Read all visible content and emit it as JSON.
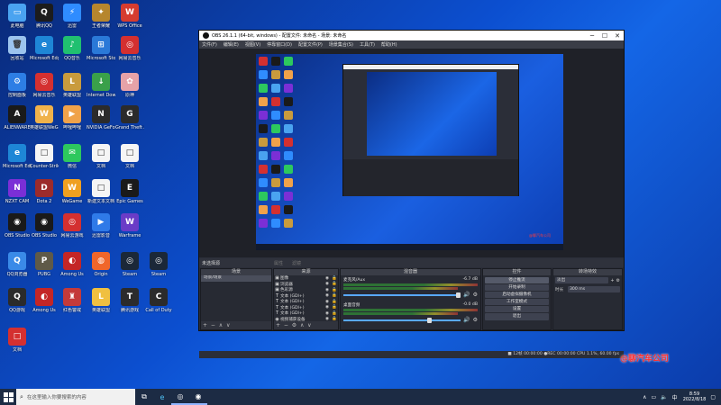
{
  "desktop": {
    "icons": [
      {
        "label": "此电脑",
        "color": "#4aa3f0",
        "glyph": "▭"
      },
      {
        "label": "腾讯QQ",
        "color": "#1c1c1c",
        "glyph": "Q"
      },
      {
        "label": "迅雷",
        "color": "#2f8cff",
        "glyph": "⚡"
      },
      {
        "label": "王者荣耀",
        "color": "#b6862e",
        "glyph": "✦"
      },
      {
        "label": "WPS Office",
        "color": "#d63c2f",
        "glyph": "W"
      },
      {
        "label": "回收站",
        "color": "#9cc4ee",
        "glyph": "🗑"
      },
      {
        "label": "Microsoft Edge",
        "color": "#1e86d6",
        "glyph": "e"
      },
      {
        "label": "QQ音乐",
        "color": "#20c070",
        "glyph": "♪"
      },
      {
        "label": "Microsoft Store",
        "color": "#2a79d8",
        "glyph": "⊞"
      },
      {
        "label": "网易云音乐",
        "color": "#d43030",
        "glyph": "◎"
      },
      {
        "label": "控制面板",
        "color": "#2d7ee5",
        "glyph": "⚙"
      },
      {
        "label": "网易云音乐",
        "color": "#d43030",
        "glyph": "◎"
      },
      {
        "label": "英雄联盟",
        "color": "#c99b3d",
        "glyph": "L"
      },
      {
        "label": "Internet Downloader",
        "color": "#3aa04a",
        "glyph": "↓"
      },
      {
        "label": "原神",
        "color": "#e6a2a8",
        "glyph": "✿"
      },
      {
        "label": "ALIENWARE",
        "color": "#1a1a1a",
        "glyph": "A"
      },
      {
        "label": "英雄联盟WeGame",
        "color": "#f0b24a",
        "glyph": "W"
      },
      {
        "label": "哔哩哔哩",
        "color": "#f0a24a",
        "glyph": "▶"
      },
      {
        "label": "NVIDIA GeForce",
        "color": "#2b2b2b",
        "glyph": "N"
      },
      {
        "label": "Grand Theft Auto",
        "color": "#2b2b2b",
        "glyph": "G"
      },
      {
        "label": "Microsoft Edge",
        "color": "#1e86d6",
        "glyph": "e"
      },
      {
        "label": "Counter-Strike",
        "color": "#f5f5f5",
        "glyph": "□"
      },
      {
        "label": "微信",
        "color": "#2dc85e",
        "glyph": "✉"
      },
      {
        "label": "文档",
        "color": "#f5f5f5",
        "glyph": "□"
      },
      {
        "label": "文档",
        "color": "#f5f5f5",
        "glyph": "□"
      },
      {
        "label": "NZXT CAM",
        "color": "#7b2fd6",
        "glyph": "N"
      },
      {
        "label": "Dota 2",
        "color": "#9c2b2b",
        "glyph": "D"
      },
      {
        "label": "WeGame",
        "color": "#f0a020",
        "glyph": "W"
      },
      {
        "label": "新建文本文档",
        "color": "#f5f5f5",
        "glyph": "□"
      },
      {
        "label": "Epic Games",
        "color": "#1a1a1a",
        "glyph": "E"
      },
      {
        "label": "OBS Studio",
        "color": "#1a1a1a",
        "glyph": "◉"
      },
      {
        "label": "OBS Studio",
        "color": "#1a1a1a",
        "glyph": "◉"
      },
      {
        "label": "网易云游戏",
        "color": "#d43030",
        "glyph": "◎"
      },
      {
        "label": "迅雷影音",
        "color": "#2f7ae8",
        "glyph": "▶"
      },
      {
        "label": "Warframe",
        "color": "#6a3cc7",
        "glyph": "W"
      },
      {
        "label": "QQ浏览器",
        "color": "#3a8ae8",
        "glyph": "Q"
      },
      {
        "label": "PUBG",
        "color": "#5f5a48",
        "glyph": "P"
      },
      {
        "label": "Among Us",
        "color": "#c42626",
        "glyph": "◐"
      },
      {
        "label": "Origin",
        "color": "#f0662a",
        "glyph": "◍"
      },
      {
        "label": "Steam",
        "color": "#1b2838",
        "glyph": "◎"
      },
      {
        "label": "Steam",
        "color": "#1b2838",
        "glyph": "◎"
      },
      {
        "label": "QQ游戏",
        "color": "#2b2b2b",
        "glyph": "Q"
      },
      {
        "label": "Among Us",
        "color": "#c42626",
        "glyph": "◐"
      },
      {
        "label": "红色警戒",
        "color": "#c43a3a",
        "glyph": "♜"
      },
      {
        "label": "英雄联盟",
        "color": "#f0c040",
        "glyph": "L"
      },
      {
        "label": "腾讯游戏",
        "color": "#2b2b2b",
        "glyph": "T"
      },
      {
        "label": "Call of Duty",
        "color": "#2b2b2b",
        "glyph": "C"
      },
      {
        "label": "文档",
        "color": "#d43030",
        "glyph": "□"
      }
    ]
  },
  "obs": {
    "title": "OBS 26.1.1 (64-bit, windows) - 配置文件: 未命名 - 场景: 未命名",
    "menu": [
      "文件(F)",
      "编辑(E)",
      "视图(V)",
      "停靠窗口(D)",
      "配置文件(P)",
      "场景集合(S)",
      "工具(T)",
      "帮助(H)"
    ],
    "scene_bar_label": "未选择源",
    "scene_bar_btns": [
      "属性",
      "滤镜"
    ],
    "docks": {
      "scenes": {
        "header": "场景",
        "items": [
          "场景/场景"
        ]
      },
      "sources": {
        "header": "来源",
        "items": [
          {
            "icon": "▣",
            "name": "图像"
          },
          {
            "icon": "▣",
            "name": "浏览器"
          },
          {
            "icon": "▣",
            "name": "色彩源"
          },
          {
            "icon": "T",
            "name": "文本 (GDI+)"
          },
          {
            "icon": "T",
            "name": "文本 (GDI+)"
          },
          {
            "icon": "T",
            "name": "文本 (GDI+)"
          },
          {
            "icon": "T",
            "name": "文本 (GDI+)"
          },
          {
            "icon": "◉",
            "name": "视频捕获设备"
          }
        ]
      },
      "mixer": {
        "header": "混音器",
        "channels": [
          {
            "name": "麦克风/Aux",
            "db": "-6.7 dB"
          },
          {
            "name": "桌面音频",
            "db": "-0.0 dB"
          }
        ]
      },
      "controls": {
        "header": "控件",
        "buttons": [
          "停止推流",
          "开始录制",
          "启动虚拟摄像机",
          "工作室模式",
          "设置",
          "退出"
        ]
      },
      "transitions": {
        "header": "转场特效",
        "type": "淡出",
        "duration_label": "时长",
        "duration": "300 ms"
      }
    },
    "footer_glyphs": {
      "add": "+",
      "remove": "−",
      "up": "∧",
      "down": "∨"
    },
    "status": "■ 12帧   00:00:00   ●REC 00:00:00   CPU 1.1%, 60.00 fps"
  },
  "watermark": "@聊汽车公司",
  "taskbar": {
    "search_placeholder": "在这里输入你要搜索的内容",
    "time": "8:59",
    "date": "2022/8/18"
  }
}
